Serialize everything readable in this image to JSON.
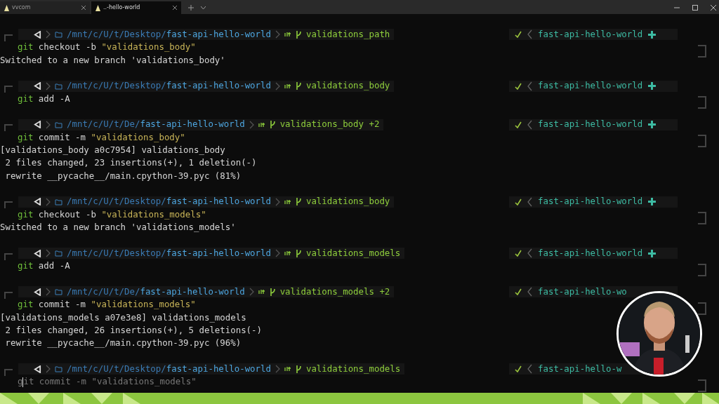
{
  "tabs": [
    {
      "label": "vvcom",
      "selected": false
    },
    {
      "label": "..-hello-world",
      "selected": true
    }
  ],
  "terminal": {
    "blocks": [
      {
        "prompt": {
          "path_dim": "/mnt/c/U/t/Desktop/",
          "path": "fast-api-hello-world",
          "branch": "validations_path",
          "right_dir": "fast-api-hello-world",
          "right_icon": true
        },
        "command": {
          "program": "git",
          "args": "checkout -b",
          "string": "\"validations_body\"",
          "suggestion": false
        },
        "output": [
          "Switched to a new branch 'validations_body'"
        ]
      },
      {
        "prompt": {
          "path_dim": "/mnt/c/U/t/Desktop/",
          "path": "fast-api-hello-world",
          "branch": "validations_body",
          "right_dir": "fast-api-hello-world",
          "right_icon": true
        },
        "command": {
          "program": "git",
          "args": "add -A",
          "suggestion": false
        }
      },
      {
        "prompt": {
          "path_dim": "/mnt/c/U/t/De/",
          "path": "fast-api-hello-world",
          "branch": "validations_body +2",
          "right_dir": "fast-api-hello-world",
          "right_icon": true
        },
        "command": {
          "program": "git",
          "args": "commit -m",
          "string": "\"validations_body\"",
          "suggestion": false
        },
        "output": [
          "[validations_body a0c7954] validations_body",
          " 2 files changed, 23 insertions(+), 1 deletion(-)",
          " rewrite __pycache__/main.cpython-39.pyc (81%)"
        ]
      },
      {
        "prompt": {
          "path_dim": "/mnt/c/U/t/Desktop/",
          "path": "fast-api-hello-world",
          "branch": "validations_body",
          "right_dir": "fast-api-hello-world",
          "right_icon": true
        },
        "command": {
          "program": "git",
          "args": "checkout -b",
          "string": "\"validations_models\"",
          "suggestion": false
        },
        "output": [
          "Switched to a new branch 'validations_models'"
        ]
      },
      {
        "prompt": {
          "path_dim": "/mnt/c/U/t/Desktop/",
          "path": "fast-api-hello-world",
          "branch": "validations_models",
          "right_dir": "fast-api-hello-world",
          "right_icon": true
        },
        "command": {
          "program": "git",
          "args": "add -A",
          "suggestion": false
        }
      },
      {
        "prompt": {
          "path_dim": "/mnt/c/U/t/De/",
          "path": "fast-api-hello-world",
          "branch": "validations_models +2",
          "right_dir": "fast-api-hello-wo",
          "right_icon": false
        },
        "command": {
          "program": "git",
          "args": "commit -m",
          "string": "\"validations_models\"",
          "suggestion": false
        },
        "output": [
          "[validations_models a07e3e8] validations_models",
          " 2 files changed, 26 insertions(+), 5 deletions(-)",
          " rewrite __pycache__/main.cpython-39.pyc (96%)"
        ]
      },
      {
        "prompt": {
          "path_dim": "/mnt/c/U/t/Desktop/",
          "path": "fast-api-hello-world",
          "branch": "validations_models",
          "right_dir": "fast-api-hello-w",
          "right_icon": false
        },
        "command": {
          "program": "git",
          "args": "commit -m",
          "string": "\"validations_models\"",
          "suggestion": true
        }
      }
    ]
  }
}
